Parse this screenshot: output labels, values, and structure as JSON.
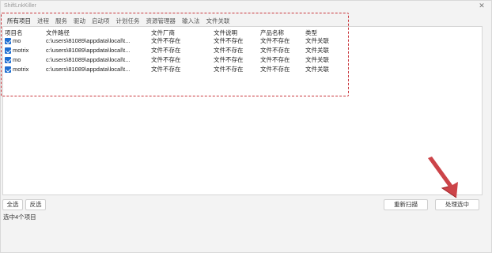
{
  "window": {
    "title": "ShiftLnkKiller",
    "close_glyph": "✕"
  },
  "tabs": [
    "所有项目",
    "进程",
    "服务",
    "驱动",
    "启动项",
    "计划任务",
    "资源管理器",
    "输入法",
    "文件关联"
  ],
  "columns": [
    "项目名",
    "文件路径",
    "文件厂商",
    "文件说明",
    "产品名称",
    "类型"
  ],
  "rows": [
    {
      "name": "mo",
      "path": "c:\\users\\81089\\appdata\\local\\t...",
      "vendor": "文件不存在",
      "description": "文件不存在",
      "product": "文件不存在",
      "type": "文件关联",
      "checked": true
    },
    {
      "name": "motrix",
      "path": "c:\\users\\81089\\appdata\\local\\t...",
      "vendor": "文件不存在",
      "description": "文件不存在",
      "product": "文件不存在",
      "type": "文件关联",
      "checked": true
    },
    {
      "name": "mo",
      "path": "c:\\users\\81089\\appdata\\local\\t...",
      "vendor": "文件不存在",
      "description": "文件不存在",
      "product": "文件不存在",
      "type": "文件关联",
      "checked": true
    },
    {
      "name": "motrix",
      "path": "c:\\users\\81089\\appdata\\local\\t...",
      "vendor": "文件不存在",
      "description": "文件不存在",
      "product": "文件不存在",
      "type": "文件关联",
      "checked": true
    }
  ],
  "buttons": {
    "select_all": "全选",
    "invert": "反选",
    "rescan": "重新扫描",
    "process_selected": "处理选中"
  },
  "status": "选中4个项目",
  "colors": {
    "accent": "#1f6fd1",
    "annotation_red": "#c8343a"
  }
}
